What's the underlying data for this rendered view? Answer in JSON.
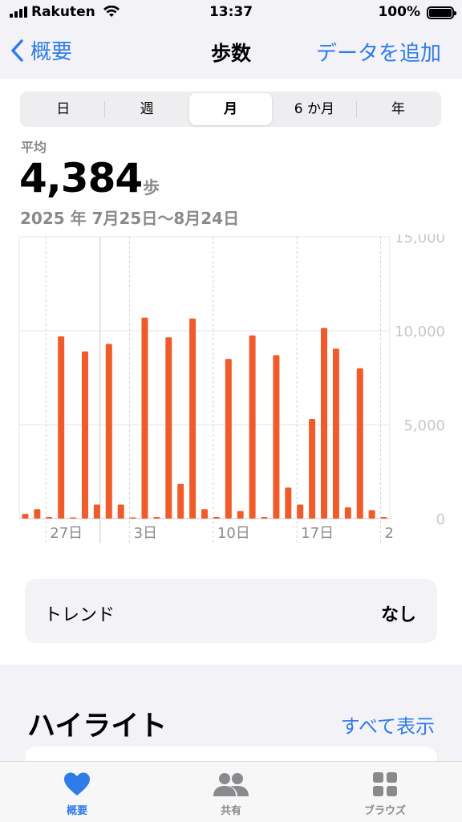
{
  "status_bar": {
    "carrier": "Rakuten",
    "time": "13:37",
    "battery": "100%"
  },
  "nav": {
    "back_label": "概要",
    "title": "歩数",
    "action_label": "データを追加"
  },
  "segments": [
    {
      "label": "日",
      "active": false
    },
    {
      "label": "週",
      "active": false
    },
    {
      "label": "月",
      "active": true
    },
    {
      "label": "6 か月",
      "active": false
    },
    {
      "label": "年",
      "active": false
    }
  ],
  "summary": {
    "label": "平均",
    "value": "4,384",
    "unit": "歩",
    "range": "2025 年 7月25日～8月24日"
  },
  "chart_data": {
    "type": "bar",
    "x": [
      "7/25",
      "7/26",
      "7/27",
      "7/28",
      "7/29",
      "7/30",
      "7/31",
      "8/1",
      "8/2",
      "8/3",
      "8/4",
      "8/5",
      "8/6",
      "8/7",
      "8/8",
      "8/9",
      "8/10",
      "8/11",
      "8/12",
      "8/13",
      "8/14",
      "8/15",
      "8/16",
      "8/17",
      "8/18",
      "8/19",
      "8/20",
      "8/21",
      "8/22",
      "8/23",
      "8/24"
    ],
    "values": [
      250,
      500,
      50,
      9700,
      0,
      8900,
      750,
      9300,
      750,
      0,
      10700,
      50,
      9650,
      1850,
      10650,
      500,
      50,
      8500,
      400,
      9750,
      50,
      8700,
      1650,
      750,
      5300,
      10150,
      9050,
      600,
      8000,
      450,
      50
    ],
    "ylim": [
      0,
      15000
    ],
    "y_ticks": [
      "0",
      "5,000",
      "10,000",
      "15,000"
    ],
    "x_tick_labels": [
      "27日",
      "3日",
      "10日",
      "17日",
      "2"
    ],
    "x_tick_positions": [
      "7/27",
      "8/3",
      "8/10",
      "8/17",
      "8/24"
    ],
    "bar_color": "#ef5b2a",
    "grid": true
  },
  "trend": {
    "label": "トレンド",
    "value": "なし"
  },
  "highlights": {
    "title": "ハイライト",
    "link": "すべて表示"
  },
  "tabs": [
    {
      "label": "概要",
      "icon": "heart-icon",
      "active": true
    },
    {
      "label": "共有",
      "icon": "people-icon",
      "active": false
    },
    {
      "label": "ブラウズ",
      "icon": "grid-icon",
      "active": false
    }
  ],
  "colors": {
    "accent": "#2f7ce8",
    "bar": "#ef5b2a"
  }
}
